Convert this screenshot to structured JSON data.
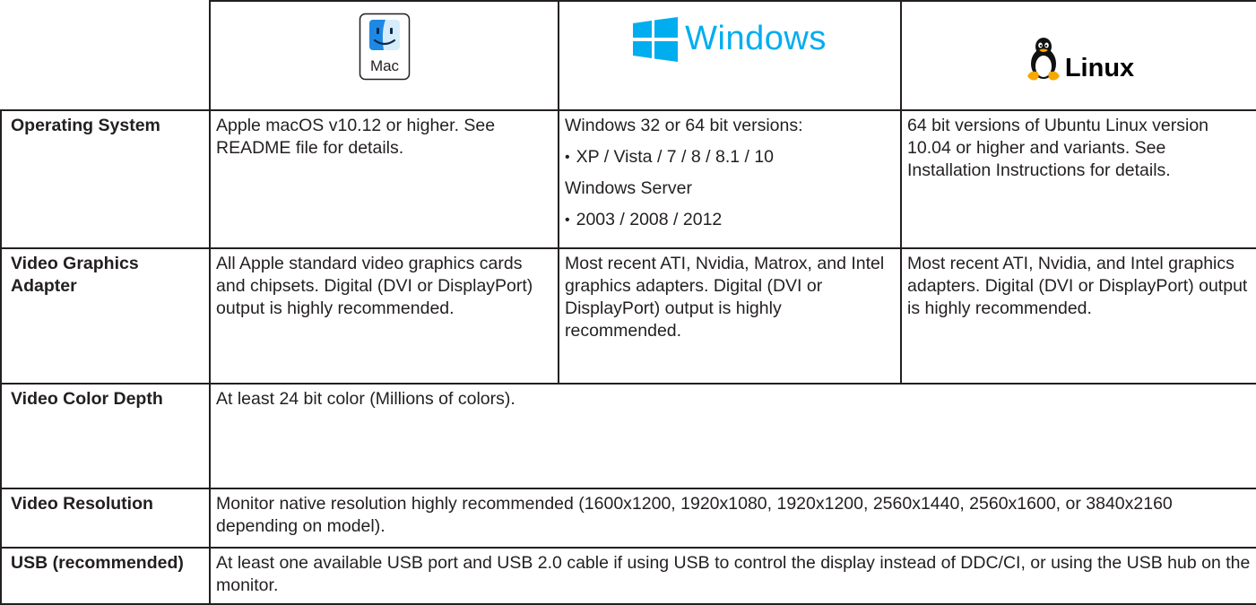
{
  "header": {
    "mac_label": "Mac",
    "windows_label": "Windows",
    "linux_label": "Linux",
    "icons": [
      "mac-finder-icon",
      "windows-icon",
      "linux-tux-icon"
    ],
    "colors": {
      "windows_blue": "#00adef",
      "mac_blue": "#1e88e5",
      "text": "#231f20"
    }
  },
  "rows": {
    "os": {
      "label": "Operating System",
      "mac": "Apple macOS v10.12 or higher. See README file for details.",
      "windows": {
        "line1": "Windows 32 or 64 bit versions:",
        "bullet1": "XP / Vista / 7 / 8 / 8.1 / 10",
        "line2": "Windows Server",
        "bullet2": "2003 / 2008 / 2012"
      },
      "linux": "64 bit versions of Ubuntu Linux version 10.04 or higher and variants. See Installation Instructions for details."
    },
    "video_adapter": {
      "label": "Video Graphics Adapter",
      "mac": "All Apple standard video graphics cards and chipsets. Digital (DVI or DisplayPort) output is highly recommended.",
      "windows": "Most recent ATI, Nvidia, Matrox, and Intel graphics adapters. Digital (DVI or DisplayPort) output is highly recommended.",
      "linux": "Most recent ATI, Nvidia, and Intel graphics adapters. Digital (DVI or DisplayPort) output is highly recommended."
    },
    "color_depth": {
      "label": "Video Color Depth",
      "value": "At least 24 bit color (Millions of colors)."
    },
    "resolution": {
      "label": "Video Resolution",
      "value": "Monitor native resolution highly recommended (1600x1200, 1920x1080, 1920x1200, 2560x1440, 2560x1600, or 3840x2160 depending on model)."
    },
    "usb": {
      "label": "USB (recommended)",
      "value": "At least one available USB port and USB 2.0 cable if using USB to control the display instead of DDC/CI, or using the USB hub on the monitor."
    }
  }
}
